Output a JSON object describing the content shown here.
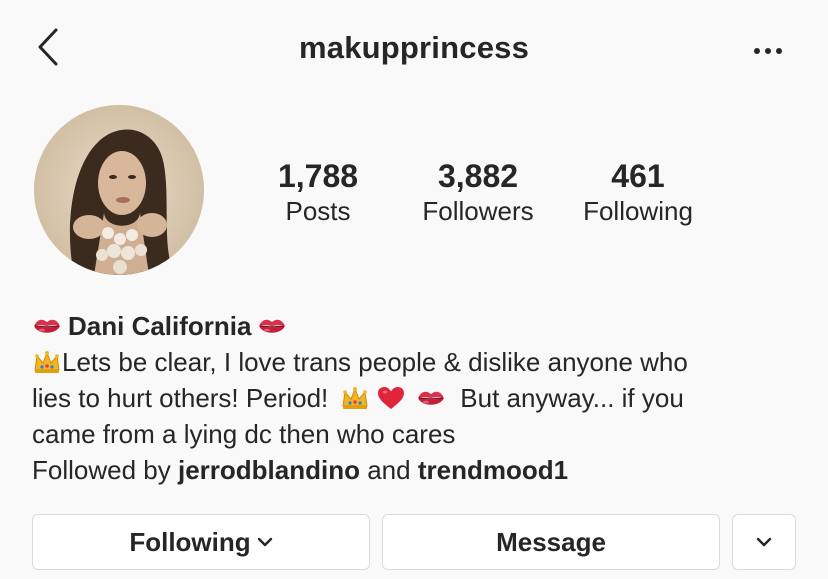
{
  "header": {
    "title": "makupprincess",
    "back_icon": "chevron-left-icon",
    "more_icon": "ellipsis-icon"
  },
  "stats": {
    "posts": {
      "value": "1,788",
      "label": "Posts"
    },
    "followers": {
      "value": "3,882",
      "label": "Followers"
    },
    "following": {
      "value": "461",
      "label": "Following"
    }
  },
  "bio": {
    "name": "Dani California",
    "line1": "Lets be clear, I love trans people & dislike anyone who",
    "line2_a": "lies to hurt others! Period!",
    "line2_b": "But anyway... if you",
    "line3": "came from a lying dc then who cares",
    "followed_prefix": "Followed by",
    "followed_user1": "jerrodblandino",
    "followed_and": "and",
    "followed_user2": "trendmood1"
  },
  "emojis": {
    "lips": "kiss-lips-emoji",
    "crown": "crown-emoji",
    "heart": "red-heart-emoji"
  },
  "buttons": {
    "following": "Following",
    "message": "Message"
  },
  "colors": {
    "text": "#262626",
    "background": "#f9f9f9",
    "button_border": "#dbdbdb"
  }
}
